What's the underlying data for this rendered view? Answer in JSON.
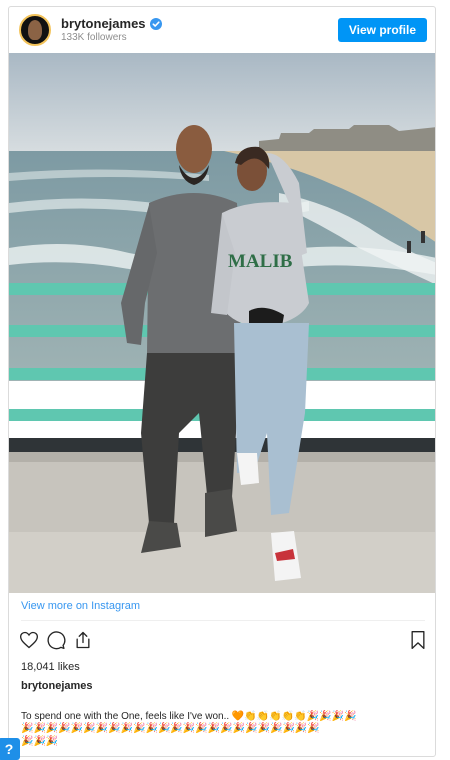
{
  "header": {
    "username": "brytonejames",
    "followers": "133K followers",
    "view_profile_label": "View profile",
    "verified_icon": "verified-badge-icon"
  },
  "photo": {
    "shirt_text": "MALIB"
  },
  "footer": {
    "view_more_label": "View more on Instagram",
    "likes": "18,041 likes",
    "caption_user": "brytonejames",
    "caption_text": "To spend one with the One, feels like I've won..",
    "caption_emoji_line1": "🧡👏👏👏👏👏🎉🎉🎉🎉",
    "caption_emoji_line2": "🎉🎉🎉🎉🎉🎉🎉🎉🎉🎉🎉🎉🎉🎉🎉🎉🎉🎉🎉🎉🎉🎉🎉🎉",
    "caption_emoji_line3": "🎉🎉🎉",
    "icons": [
      "heart-icon",
      "comment-icon",
      "share-icon",
      "bookmark-icon"
    ]
  },
  "colors": {
    "accent": "#0095f6",
    "link": "#3897f0",
    "railing": "#5fc7b0"
  }
}
